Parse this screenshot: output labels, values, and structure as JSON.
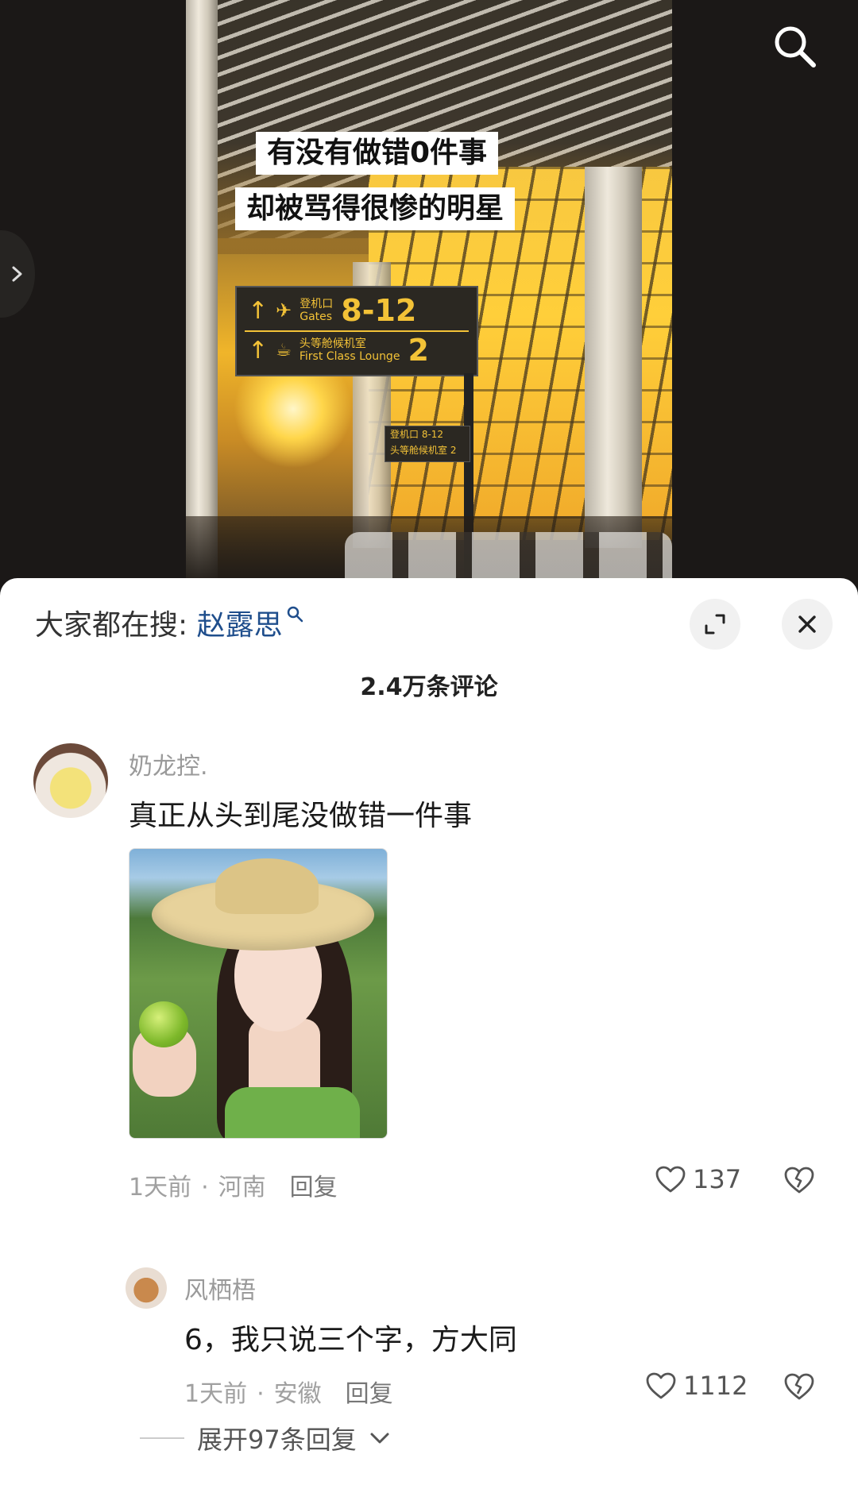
{
  "video": {
    "caption_line1": "有没有做错0件事",
    "caption_line2": "却被骂得很惨的明星",
    "sign": {
      "row1_cn": "登机口",
      "row1_en": "Gates",
      "row1_num": "8-12",
      "row2_cn": "头等舱候机室",
      "row2_en": "First Class Lounge",
      "row2_num": "2"
    },
    "sign2": {
      "line1": "登机口 8-12",
      "line2": "头等舱候机室 2"
    }
  },
  "sheet": {
    "search_prefix": "大家都在搜:",
    "search_term": "赵露思",
    "comment_count": "2.4万条评论"
  },
  "comments": [
    {
      "username": "奶龙控.",
      "text": "真正从头到尾没做错一件事",
      "time": "1天前",
      "location": "河南",
      "reply_label": "回复",
      "likes": "137"
    },
    {
      "username": "风栖梧",
      "text": "6，我只说三个字，方大同",
      "time": "1天前",
      "location": "安徽",
      "reply_label": "回复",
      "likes": "1112"
    }
  ],
  "expand_replies": "展开97条回复",
  "colors": {
    "link": "#1f4e8c",
    "sheet_bg": "#ffffff",
    "video_bg": "#1b1817"
  },
  "icons": [
    "search-icon",
    "chevron-right-icon",
    "expand-icon",
    "close-icon",
    "heart-icon",
    "broken-heart-icon",
    "chevron-down-icon"
  ]
}
